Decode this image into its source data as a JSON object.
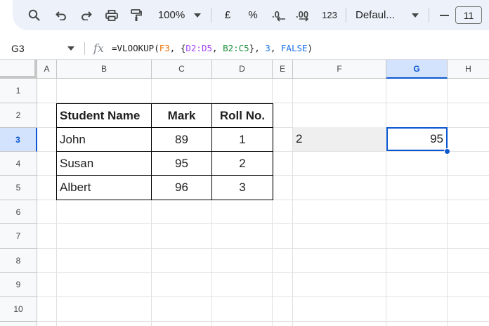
{
  "toolbar": {
    "zoom": "100%",
    "currency": "£",
    "percent": "%",
    "number_format": "123",
    "font_name": "Defaul...",
    "font_size": "11",
    "colors": {
      "background": "#edf2fa",
      "icon": "#444746"
    }
  },
  "formula_bar": {
    "cell_ref": "G3",
    "fx_label": "fx",
    "formula_parts": [
      {
        "text": "=VLOOKUP(",
        "color": "#1f1f1f"
      },
      {
        "text": "F3",
        "color": "#e8710a"
      },
      {
        "text": ", {",
        "color": "#1f1f1f"
      },
      {
        "text": "D2:D5",
        "color": "#a142f4"
      },
      {
        "text": ", ",
        "color": "#1f1f1f"
      },
      {
        "text": "B2:C5",
        "color": "#1e8e3e"
      },
      {
        "text": "}, ",
        "color": "#1f1f1f"
      },
      {
        "text": "3",
        "color": "#1a73e8"
      },
      {
        "text": ", ",
        "color": "#1f1f1f"
      },
      {
        "text": "FALSE",
        "color": "#1a73e8"
      },
      {
        "text": ")",
        "color": "#1f1f1f"
      }
    ]
  },
  "grid": {
    "columns": [
      "A",
      "B",
      "C",
      "D",
      "E",
      "F",
      "G",
      "H"
    ],
    "rows": [
      "1",
      "2",
      "3",
      "4",
      "5",
      "6",
      "7",
      "8",
      "9",
      "10"
    ],
    "selected_column": "G",
    "selected_row": "3",
    "colors": {
      "selection": "#0b57d0",
      "header_selected": "#d3e3fd",
      "f3_fill": "#efefef"
    }
  },
  "table": {
    "headers": [
      "Student Name",
      "Mark",
      "Roll No."
    ],
    "rows": [
      [
        "John",
        "89",
        "1"
      ],
      [
        "Susan",
        "95",
        "2"
      ],
      [
        "Albert",
        "96",
        "3"
      ]
    ]
  },
  "cells": {
    "F3": "2",
    "G3": "95"
  }
}
